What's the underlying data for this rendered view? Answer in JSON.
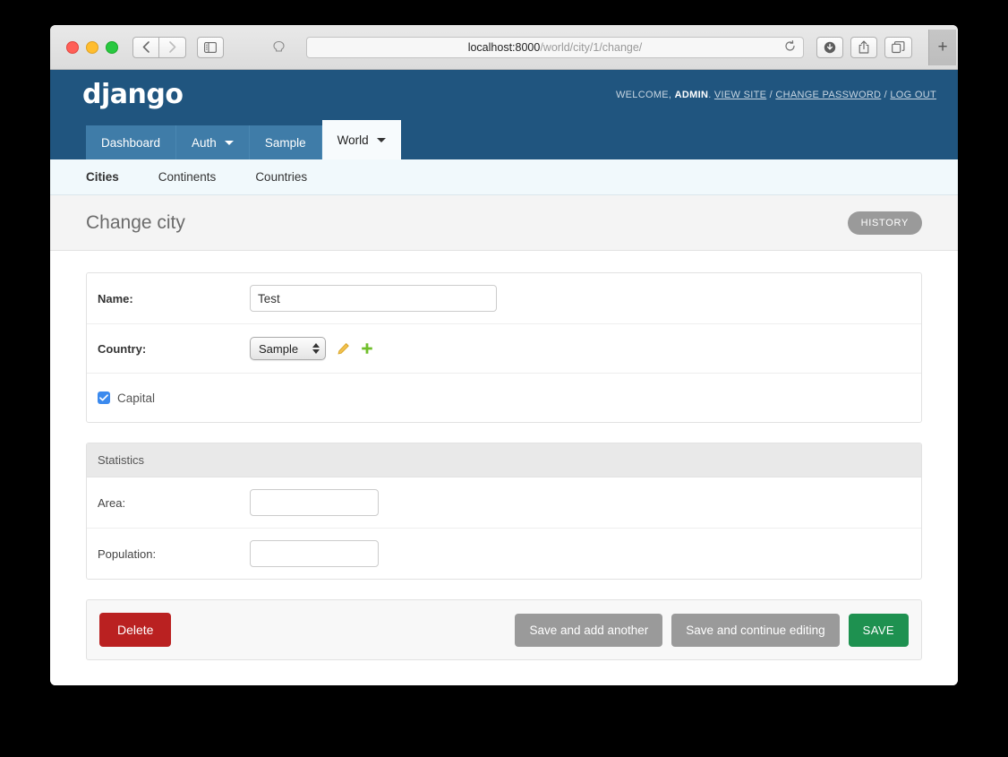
{
  "browser": {
    "url_host": "localhost:8000",
    "url_path": "/world/city/1/change/",
    "back_icon": "chevron-left-icon",
    "forward_icon": "chevron-right-icon",
    "sidebar_icon": "sidebar-toggle-icon",
    "reader_icon": "reader-view-icon",
    "reload_icon": "reload-icon",
    "downloads_icon": "downloads-icon",
    "share_icon": "share-icon",
    "tabs_icon": "show-tabs-icon",
    "new_tab_label": "+"
  },
  "header": {
    "logo": "django",
    "welcome_prefix": "WELCOME,",
    "username": "ADMIN",
    "welcome_suffix": ".",
    "links": [
      {
        "label": "VIEW SITE"
      },
      {
        "label": "CHANGE PASSWORD"
      },
      {
        "label": "LOG OUT"
      }
    ],
    "separator": "/"
  },
  "nav": {
    "tabs": [
      {
        "label": "Dashboard",
        "has_caret": false,
        "active": false
      },
      {
        "label": "Auth",
        "has_caret": true,
        "active": false
      },
      {
        "label": "Sample",
        "has_caret": false,
        "active": false
      },
      {
        "label": "World",
        "has_caret": true,
        "active": true
      }
    ],
    "sub_items": [
      {
        "label": "Cities",
        "current": true
      },
      {
        "label": "Continents",
        "current": false
      },
      {
        "label": "Countries",
        "current": false
      }
    ]
  },
  "page": {
    "title": "Change city",
    "history_label": "HISTORY"
  },
  "form": {
    "main_fields": [
      {
        "label": "Name:",
        "value": "Test",
        "placeholder": ""
      }
    ],
    "country": {
      "label": "Country:",
      "selected": "Sample",
      "edit_icon": "pencil-edit-icon",
      "add_icon": "plus-add-icon",
      "add_glyph": "✚"
    },
    "capital": {
      "label": "Capital",
      "checked": true
    },
    "statistics": {
      "legend": "Statistics",
      "fields": [
        {
          "label": "Area:",
          "value": "",
          "placeholder": ""
        },
        {
          "label": "Population:",
          "value": "",
          "placeholder": ""
        }
      ]
    }
  },
  "actions": {
    "delete": "Delete",
    "save_add_another": "Save and add another",
    "save_continue": "Save and continue editing",
    "save": "SAVE"
  },
  "colors": {
    "django_blue": "#20557f",
    "tab_blue": "#3f7ca8",
    "subnav_bg": "#f1f9fc",
    "delete_red": "#ba2121",
    "save_green": "#1e9150",
    "grey_button": "#9a9a9a",
    "checkbox_blue": "#3b8aee"
  }
}
